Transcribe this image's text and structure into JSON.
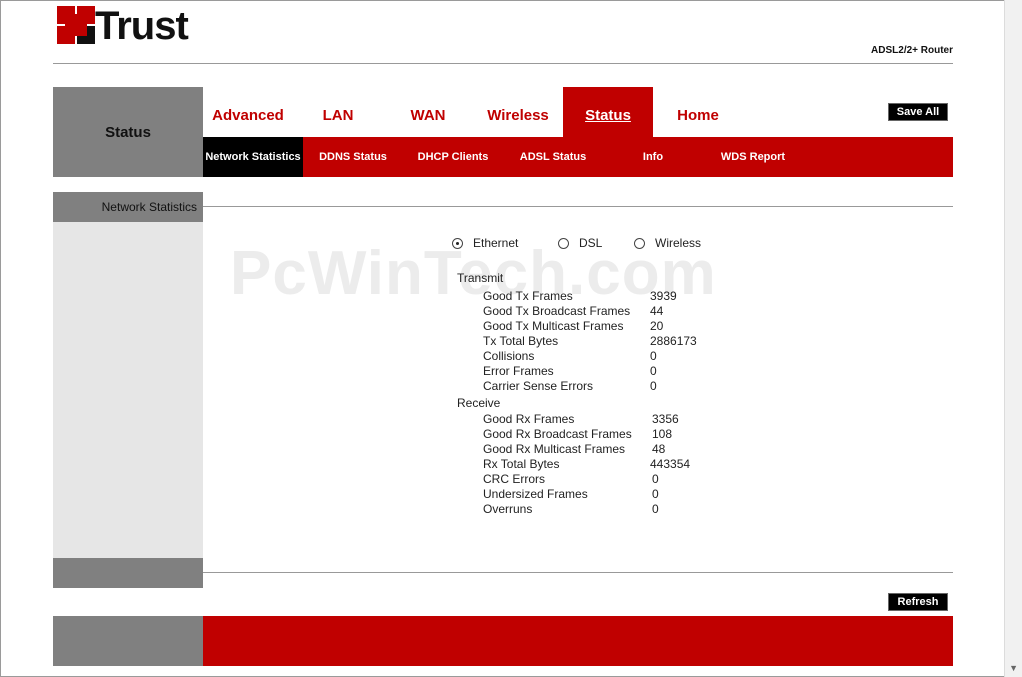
{
  "brand": {
    "logo_text": "Trust",
    "model": "ADSL2/2+ Router"
  },
  "section_title": "Status",
  "topnav": [
    {
      "label": "Advanced",
      "active": false
    },
    {
      "label": "LAN",
      "active": false
    },
    {
      "label": "WAN",
      "active": false
    },
    {
      "label": "Wireless",
      "active": false
    },
    {
      "label": "Status",
      "active": true
    },
    {
      "label": "Home",
      "active": false
    }
  ],
  "save_all_label": "Save All",
  "subnav": [
    {
      "label": "Network Statistics",
      "active": true
    },
    {
      "label": "DDNS Status",
      "active": false
    },
    {
      "label": "DHCP Clients",
      "active": false
    },
    {
      "label": "ADSL Status",
      "active": false
    },
    {
      "label": "Info",
      "active": false
    },
    {
      "label": "WDS Report",
      "active": false
    }
  ],
  "sidebar_title": "Network Statistics",
  "watermark": "PcWinTech.com",
  "interface_options": [
    {
      "label": "Ethernet",
      "selected": true
    },
    {
      "label": "DSL",
      "selected": false
    },
    {
      "label": "Wireless",
      "selected": false
    }
  ],
  "transmit": {
    "title": "Transmit",
    "rows": [
      {
        "label": "Good Tx Frames",
        "value": "3939"
      },
      {
        "label": "Good Tx Broadcast Frames",
        "value": "44"
      },
      {
        "label": "Good Tx Multicast Frames",
        "value": "20"
      },
      {
        "label": "Tx Total Bytes",
        "value": "2886173"
      },
      {
        "label": "Collisions",
        "value": "0"
      },
      {
        "label": "Error Frames",
        "value": "0"
      },
      {
        "label": "Carrier Sense Errors",
        "value": "0"
      }
    ]
  },
  "receive": {
    "title": "Receive",
    "rows": [
      {
        "label": "Good Rx Frames",
        "value": "3356"
      },
      {
        "label": "Good Rx Broadcast Frames",
        "value": "108"
      },
      {
        "label": "Good Rx Multicast Frames",
        "value": "48"
      },
      {
        "label": "Rx Total Bytes",
        "value": "443354"
      },
      {
        "label": "CRC Errors",
        "value": "0"
      },
      {
        "label": "Undersized Frames",
        "value": "0"
      },
      {
        "label": "Overruns",
        "value": "0"
      }
    ]
  },
  "refresh_label": "Refresh",
  "colors": {
    "brand_red": "#c00000",
    "panel_grey": "#808080",
    "sidebar_bg": "#e6e6e6"
  }
}
